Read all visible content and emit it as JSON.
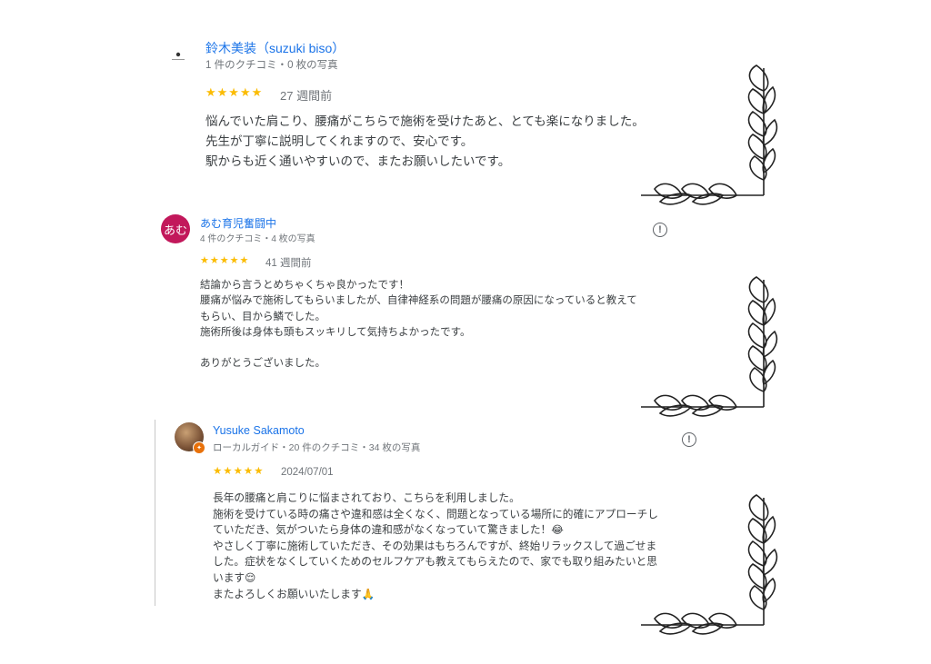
{
  "reviews": [
    {
      "reviewer_name": "鈴木美装（suzuki biso）",
      "reviewer_meta": "1 件のクチコミ・0 枚の写真",
      "rating": 5,
      "stars": "★★★★★",
      "date": "27 週間前",
      "lines": [
        "悩んでいた肩こり、腰痛がこちらで施術を受けたあと、とても楽になりました。",
        "先生が丁寧に説明してくれますので、安心です。",
        "駅からも近く通いやすいので、またお願いしたいです。"
      ]
    },
    {
      "avatar_text": "あむ",
      "avatar_color": "#c2185b",
      "reviewer_name": "あむ育児奮闘中",
      "reviewer_meta": "4 件のクチコミ・4 枚の写真",
      "rating": 5,
      "stars": "★★★★★",
      "date": "41 週間前",
      "lines": [
        "結論から言うとめちゃくちゃ良かったです！",
        "腰痛が悩みで施術してもらいましたが、自律神経系の問題が腰痛の原因になっていると教えて",
        "もらい、目から鱗でした。",
        "施術所後は身体も頭もスッキリして気持ちよかったです。",
        "",
        "ありがとうございました。"
      ]
    },
    {
      "reviewer_name": "Yusuke Sakamoto",
      "reviewer_meta": "ローカルガイド・20 件のクチコミ・34 枚の写真",
      "rating": 5,
      "stars": "★★★★★",
      "date": "2024/07/01",
      "lines": [
        "長年の腰痛と肩こりに悩まされており、こちらを利用しました。",
        "施術を受けている時の痛さや違和感は全くなく、問題となっている場所に的確にアプローチし",
        "ていただき、気がついたら身体の違和感がなくなっていて驚きました！😂",
        "やさしく丁寧に施術していただき、その効果はもちろんですが、終始リラックスして過ごせま",
        "した。症状をなくしていくためのセルフケアも教えてもらえたので、家でも取り組みたいと思",
        "います😌",
        "またよろしくお願いいたします🙏"
      ]
    }
  ],
  "icons": {
    "flag": "!",
    "local_guide_badge": "✦"
  },
  "colors": {
    "star": "#fbbc04",
    "name": "#1a73e8",
    "meta": "#70757a"
  }
}
